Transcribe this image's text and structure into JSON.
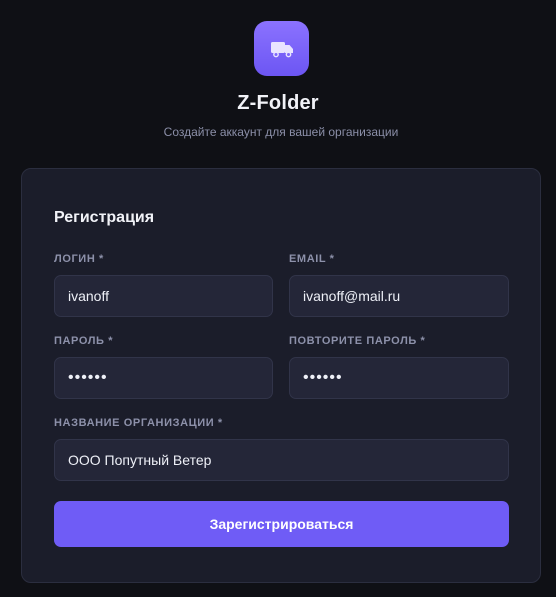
{
  "app": {
    "logo_icon": "truck-icon",
    "title": "Z-Folder",
    "subtitle": "Создайте аккаунт для вашей организации"
  },
  "form": {
    "title": "Регистрация",
    "login": {
      "label": "ЛОГИН *",
      "value": "ivanoff"
    },
    "email": {
      "label": "EMAIL *",
      "value": "ivanoff@mail.ru"
    },
    "password": {
      "label": "ПАРОЛЬ *",
      "value": "••••••"
    },
    "password_repeat": {
      "label": "ПОВТОРИТЕ ПАРОЛЬ *",
      "value": "••••••"
    },
    "organization": {
      "label": "НАЗВАНИЕ ОРГАНИЗАЦИИ *",
      "value": "ООО Попутный Ветер"
    },
    "submit_label": "Зарегистрироваться"
  },
  "colors": {
    "background": "#0f1015",
    "card": "#1b1d2a",
    "input": "#242638",
    "accent": "#6f5cf6"
  }
}
